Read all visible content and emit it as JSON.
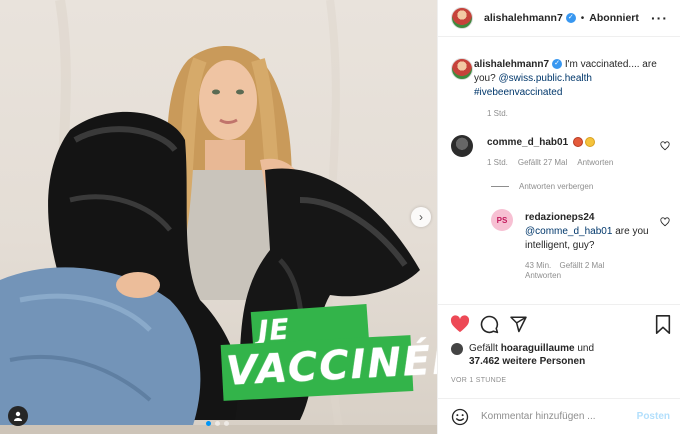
{
  "header": {
    "username": "alishalehmann7",
    "separator": "•",
    "follow_label": "Abonniert",
    "more_icon": "more-icon"
  },
  "caption": {
    "username": "alishalehmann7",
    "text": "I'm vaccinated.... are you?",
    "mention": "@swiss.public.health",
    "hashtag": "#ivebeenvaccinated",
    "time": "1 Std."
  },
  "comments": [
    {
      "username": "comme_d_hab01",
      "time": "1 Std.",
      "likes": "Gefällt 27 Mal",
      "reply_label": "Antworten"
    }
  ],
  "hide_replies_label": "Antworten verbergen",
  "replies": [
    {
      "avatar_text": "PS",
      "username": "redazioneps24",
      "mention": "@comme_d_hab01",
      "text": "are you intelligent, guy?",
      "time": "43 Min.",
      "likes": "Gefällt 2 Mal",
      "reply_label": "Antworten"
    }
  ],
  "likes_line": {
    "prefix": "Gefällt",
    "user": "hoaraguillaume",
    "joiner": "und",
    "others": "37.462 weitere Personen"
  },
  "timeago": "VOR 1 STUNDE",
  "comment_box": {
    "placeholder": "Kommentar hinzufügen ...",
    "post_label": "Posten"
  },
  "overlay": {
    "line1": "JE SUIS",
    "line2": "VACCINÉE"
  },
  "colors": {
    "like_red": "#ed4956",
    "link_blue": "#00376b",
    "accent_green": "#33b44a",
    "verified_blue": "#3897f0"
  },
  "carousel": {
    "current": 1,
    "total": 3
  }
}
